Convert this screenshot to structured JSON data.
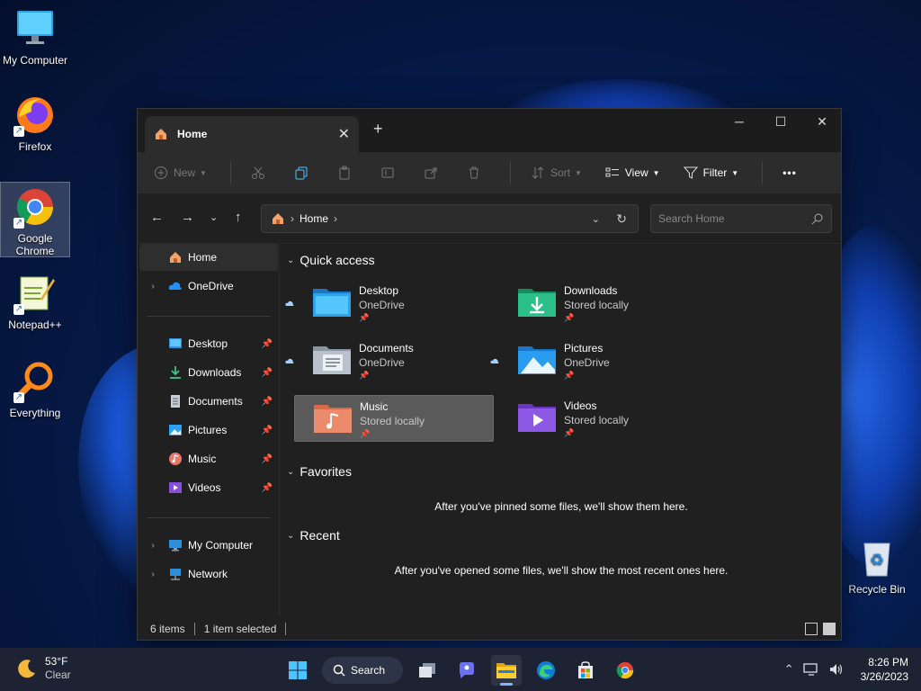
{
  "desktop": {
    "icons": [
      {
        "label": "My Computer",
        "icon": "monitor-icon"
      },
      {
        "label": "Firefox",
        "icon": "firefox-icon"
      },
      {
        "label": "Google Chrome",
        "icon": "chrome-icon"
      },
      {
        "label": "Notepad++",
        "icon": "notepadpp-icon"
      },
      {
        "label": "Everything",
        "icon": "everything-icon"
      },
      {
        "label": "Recycle Bin",
        "icon": "recycle-bin-icon"
      }
    ]
  },
  "window": {
    "tab_title": "Home",
    "controls": {
      "minimize": "─",
      "maximize": "☐",
      "close": "✕",
      "tab_close": "✕",
      "new_tab": "+"
    }
  },
  "toolbar": {
    "new_label": "New",
    "sort_label": "Sort",
    "view_label": "View",
    "filter_label": "Filter",
    "more_label": "•••"
  },
  "address": {
    "crumb": "Home",
    "search_placeholder": "Search Home"
  },
  "sidebar": {
    "home": "Home",
    "onedrive": "OneDrive",
    "pinned": [
      {
        "label": "Desktop",
        "icon": "desktop-folder-icon"
      },
      {
        "label": "Downloads",
        "icon": "downloads-icon"
      },
      {
        "label": "Documents",
        "icon": "documents-icon"
      },
      {
        "label": "Pictures",
        "icon": "pictures-icon"
      },
      {
        "label": "Music",
        "icon": "music-icon"
      },
      {
        "label": "Videos",
        "icon": "videos-icon"
      }
    ],
    "my_computer": "My Computer",
    "network": "Network"
  },
  "quick_access": {
    "heading": "Quick access",
    "items": [
      {
        "name": "Desktop",
        "location": "OneDrive",
        "cloud": true
      },
      {
        "name": "Downloads",
        "location": "Stored locally",
        "cloud": false
      },
      {
        "name": "Documents",
        "location": "OneDrive",
        "cloud": true
      },
      {
        "name": "Pictures",
        "location": "OneDrive",
        "cloud": true
      },
      {
        "name": "Music",
        "location": "Stored locally",
        "cloud": false,
        "selected": true
      },
      {
        "name": "Videos",
        "location": "Stored locally",
        "cloud": false
      }
    ]
  },
  "favorites": {
    "heading": "Favorites",
    "empty_message": "After you've pinned some files, we'll show them here."
  },
  "recent": {
    "heading": "Recent",
    "empty_message": "After you've opened some files, we'll show the most recent ones here."
  },
  "status": {
    "items": "6 items",
    "selected": "1 item selected"
  },
  "taskbar": {
    "weather_temp": "53°F",
    "weather_desc": "Clear",
    "search_label": "Search",
    "time": "8:26 PM",
    "date": "3/26/2023"
  },
  "colors": {
    "accent": "#4cc2ff",
    "window_bg": "#202020",
    "selected_tile": "#5a5a5a"
  }
}
